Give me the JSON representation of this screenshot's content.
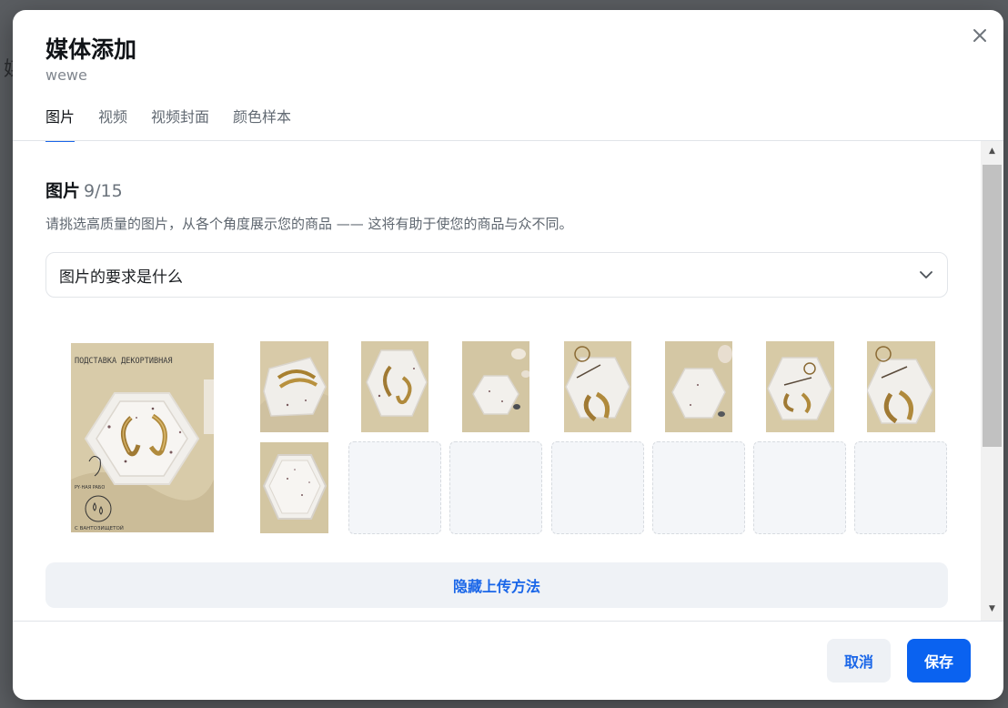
{
  "modal": {
    "title": "媒体添加",
    "subtitle": "wewe"
  },
  "tabs": [
    {
      "label": "图片",
      "active": true
    },
    {
      "label": "视频",
      "active": false
    },
    {
      "label": "视频封面",
      "active": false
    },
    {
      "label": "颜色样本",
      "active": false
    }
  ],
  "section": {
    "title": "图片",
    "count": "9/15",
    "description": "请挑选高质量的图片，从各个角度展示您的商品 —— 这将有助于使您的商品与众不同。"
  },
  "requirements": {
    "label": "图片的要求是什么",
    "icon": "chevron-down-icon"
  },
  "main_image": {
    "banner": "ПОДСТАВКА ДЕКОРТИВНАЯ",
    "footer": "С ВАНТОЗИЩЕТОЙ"
  },
  "gallery": {
    "filled_thumbnails": 8,
    "empty_slots": 6
  },
  "hide_upload_label": "隐藏上传方法",
  "footer": {
    "cancel_label": "取消",
    "save_label": "保存"
  },
  "colors": {
    "accent": "#1a66e8",
    "save_bg": "#0a62f0",
    "photo_bg": "#d8cba9",
    "tray": "#f2f0ed"
  }
}
